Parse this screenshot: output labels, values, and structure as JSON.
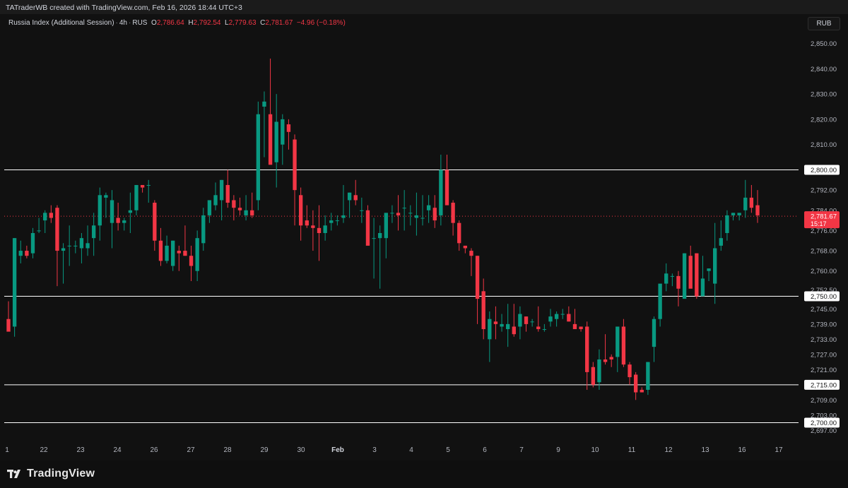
{
  "header": {
    "author_text": "TATraderWB created with TradingView.com, Feb 16, 2026 18:44 UTC+3"
  },
  "legend": {
    "symbol": "Russia Index (Additional Session)",
    "interval": "4h",
    "exchange": "RUS",
    "open_label": "O",
    "open_value": "2,786.64",
    "high_label": "H",
    "high_value": "2,792.54",
    "low_label": "L",
    "low_value": "2,779.63",
    "close_label": "C",
    "close_value": "2,781.67",
    "change": "−4.96 (−0.18%)"
  },
  "currency_button": "RUB",
  "footer": {
    "logo_text": "TradingView",
    "logo_icon": "tradingview-logo-icon"
  },
  "colors": {
    "up": "#089981",
    "down": "#f23645",
    "background": "#111111",
    "text": "#d1d4dc",
    "hline": "#ffffff"
  },
  "chart_data": {
    "type": "candlestick",
    "y_range": [
      2694,
      2856
    ],
    "y_ticks": [
      "2,850.00",
      "2,840.00",
      "2,830.00",
      "2,820.00",
      "2,810.00",
      "2,792.00",
      "2,784.00",
      "2,776.00",
      "2,768.00",
      "2,760.00",
      "2,752.50",
      "2,745.00",
      "2,739.00",
      "2,733.00",
      "2,727.00",
      "2,721.00",
      "2,709.00",
      "2,703.00",
      "2,697.00"
    ],
    "x_labels": [
      "1",
      "22",
      "23",
      "24",
      "26",
      "27",
      "28",
      "29",
      "30",
      "Feb",
      "3",
      "4",
      "5",
      "6",
      "7",
      "9",
      "10",
      "11",
      "12",
      "13",
      "16",
      "17"
    ],
    "hlines": [
      {
        "value": 2800,
        "label": "2,800.00"
      },
      {
        "value": 2750,
        "label": "2,750.00"
      },
      {
        "value": 2715,
        "label": "2,715.00"
      },
      {
        "value": 2700,
        "label": "2,700.00"
      }
    ],
    "last_price": {
      "value": 2781.67,
      "label": "2,781.67",
      "countdown": "15:17"
    },
    "candles": [
      [
        2741,
        2748,
        2737,
        2736
      ],
      [
        2738,
        2773,
        2734,
        2773
      ],
      [
        2766,
        2772,
        2763,
        2768
      ],
      [
        2768,
        2770,
        2765,
        2766
      ],
      [
        2767,
        2777,
        2765,
        2775
      ],
      [
        2776,
        2781,
        2775,
        2776
      ],
      [
        2780,
        2784,
        2775,
        2783
      ],
      [
        2783,
        2786,
        2779,
        2781
      ],
      [
        2785,
        2786,
        2754,
        2768
      ],
      [
        2768,
        2771,
        2755,
        2769
      ],
      [
        2770,
        2778,
        2762,
        2770
      ],
      [
        2770,
        2772,
        2767,
        2770
      ],
      [
        2769,
        2775,
        2763,
        2773
      ],
      [
        2769,
        2778,
        2766,
        2771
      ],
      [
        2773,
        2783,
        2766,
        2778
      ],
      [
        2778,
        2793,
        2772,
        2790
      ],
      [
        2789,
        2791,
        2781,
        2790
      ],
      [
        2779,
        2792,
        2769,
        2788
      ],
      [
        2781,
        2787,
        2776,
        2779
      ],
      [
        2779,
        2781,
        2776,
        2780
      ],
      [
        2783,
        2791,
        2775,
        2784
      ],
      [
        2784,
        2794,
        2782,
        2794
      ],
      [
        2794,
        2794,
        2791,
        2793
      ],
      [
        2794,
        2796,
        2787,
        2794
      ],
      [
        2787,
        2788,
        2768,
        2772
      ],
      [
        2772,
        2777,
        2762,
        2764
      ],
      [
        2764,
        2774,
        2763,
        2770
      ],
      [
        2762,
        2772,
        2760,
        2772
      ],
      [
        2768,
        2770,
        2760,
        2767
      ],
      [
        2768,
        2778,
        2766,
        2766
      ],
      [
        2766,
        2770,
        2756,
        2762
      ],
      [
        2760,
        2776,
        2756,
        2773
      ],
      [
        2771,
        2785,
        2768,
        2782
      ],
      [
        2782,
        2787,
        2779,
        2788
      ],
      [
        2786,
        2795,
        2784,
        2790
      ],
      [
        2788,
        2796,
        2780,
        2796
      ],
      [
        2794,
        2800,
        2785,
        2787
      ],
      [
        2788,
        2790,
        2780,
        2785
      ],
      [
        2785,
        2789,
        2782,
        2784
      ],
      [
        2782,
        2790,
        2780,
        2784
      ],
      [
        2784,
        2791,
        2781,
        2782
      ],
      [
        2788,
        2827,
        2784,
        2822
      ],
      [
        2825,
        2831,
        2805,
        2827
      ],
      [
        2822,
        2844,
        2810,
        2802
      ],
      [
        2803,
        2830,
        2793,
        2819
      ],
      [
        2810,
        2822,
        2802,
        2820
      ],
      [
        2818,
        2820,
        2808,
        2815
      ],
      [
        2812,
        2814,
        2778,
        2792
      ],
      [
        2790,
        2793,
        2772,
        2778
      ],
      [
        2780,
        2786,
        2777,
        2778
      ],
      [
        2778,
        2784,
        2768,
        2777
      ],
      [
        2777,
        2786,
        2764,
        2775
      ],
      [
        2775,
        2782,
        2772,
        2778
      ],
      [
        2779,
        2783,
        2776,
        2780
      ],
      [
        2780,
        2782,
        2778,
        2780
      ],
      [
        2781,
        2794,
        2779,
        2782
      ],
      [
        2788,
        2791,
        2781,
        2791
      ],
      [
        2790,
        2796,
        2786,
        2788
      ],
      [
        2784,
        2789,
        2779,
        2784
      ],
      [
        2784,
        2786,
        2774,
        2770
      ],
      [
        2773,
        2781,
        2757,
        2773
      ],
      [
        2773,
        2778,
        2753,
        2775
      ],
      [
        2773,
        2782,
        2765,
        2783
      ],
      [
        2783,
        2786,
        2779,
        2783
      ],
      [
        2783,
        2790,
        2776,
        2782
      ],
      [
        2785,
        2792,
        2776,
        2785
      ],
      [
        2783,
        2786,
        2778,
        2783
      ],
      [
        2781,
        2791,
        2774,
        2782
      ],
      [
        2781,
        2790,
        2778,
        2781
      ],
      [
        2784,
        2790,
        2779,
        2786
      ],
      [
        2785,
        2790,
        2777,
        2780
      ],
      [
        2782,
        2806,
        2778,
        2800
      ],
      [
        2800,
        2806,
        2788,
        2786
      ],
      [
        2787,
        2788,
        2774,
        2779
      ],
      [
        2779,
        2780,
        2768,
        2771
      ],
      [
        2770,
        2770,
        2767,
        2769
      ],
      [
        2768,
        2769,
        2758,
        2766
      ],
      [
        2766,
        2766,
        2739,
        2749
      ],
      [
        2752,
        2757,
        2733,
        2737
      ],
      [
        2733,
        2744,
        2724,
        2741
      ],
      [
        2740,
        2746,
        2733,
        2739
      ],
      [
        2738,
        2743,
        2736,
        2739
      ],
      [
        2737,
        2747,
        2730,
        2739
      ],
      [
        2738,
        2747,
        2734,
        2735
      ],
      [
        2738,
        2746,
        2733,
        2743
      ],
      [
        2742,
        2742,
        2736,
        2739
      ],
      [
        2740,
        2741,
        2738,
        2740
      ],
      [
        2738,
        2746,
        2736,
        2737
      ],
      [
        2737,
        2739,
        2736,
        2737
      ],
      [
        2740,
        2745,
        2738,
        2742
      ],
      [
        2741,
        2744,
        2738,
        2743
      ],
      [
        2743,
        2745,
        2741,
        2743
      ],
      [
        2743,
        2746,
        2740,
        2740
      ],
      [
        2739,
        2745,
        2738,
        2737
      ],
      [
        2738,
        2738,
        2736,
        2737
      ],
      [
        2738,
        2740,
        2713,
        2720
      ],
      [
        2722,
        2724,
        2714,
        2715
      ],
      [
        2716,
        2729,
        2713,
        2725
      ],
      [
        2725,
        2735,
        2723,
        2724
      ],
      [
        2726,
        2727,
        2722,
        2725
      ],
      [
        2726,
        2738,
        2720,
        2738
      ],
      [
        2738,
        2741,
        2722,
        2723
      ],
      [
        2723,
        2724,
        2715,
        2718
      ],
      [
        2719,
        2720,
        2709,
        2712
      ],
      [
        2713,
        2714,
        2712,
        2712
      ],
      [
        2713,
        2724,
        2711,
        2724
      ],
      [
        2730,
        2742,
        2724,
        2741
      ],
      [
        2741,
        2752,
        2738,
        2755
      ],
      [
        2755,
        2763,
        2752,
        2759
      ],
      [
        2758,
        2759,
        2754,
        2758
      ],
      [
        2758,
        2760,
        2746,
        2753
      ],
      [
        2749,
        2767,
        2749,
        2767
      ],
      [
        2766,
        2770,
        2754,
        2753
      ],
      [
        2767,
        2767,
        2749,
        2750
      ],
      [
        2750,
        2766,
        2750,
        2757
      ],
      [
        2760,
        2761,
        2756,
        2761
      ],
      [
        2755,
        2779,
        2747,
        2769
      ],
      [
        2770,
        2780,
        2768,
        2773
      ],
      [
        2775,
        2784,
        2772,
        2782
      ],
      [
        2782,
        2783,
        2780,
        2783
      ],
      [
        2782,
        2782,
        2780,
        2783
      ],
      [
        2784,
        2796,
        2781,
        2789
      ],
      [
        2789,
        2794,
        2783,
        2785
      ],
      [
        2786,
        2792,
        2779,
        2782
      ]
    ]
  }
}
